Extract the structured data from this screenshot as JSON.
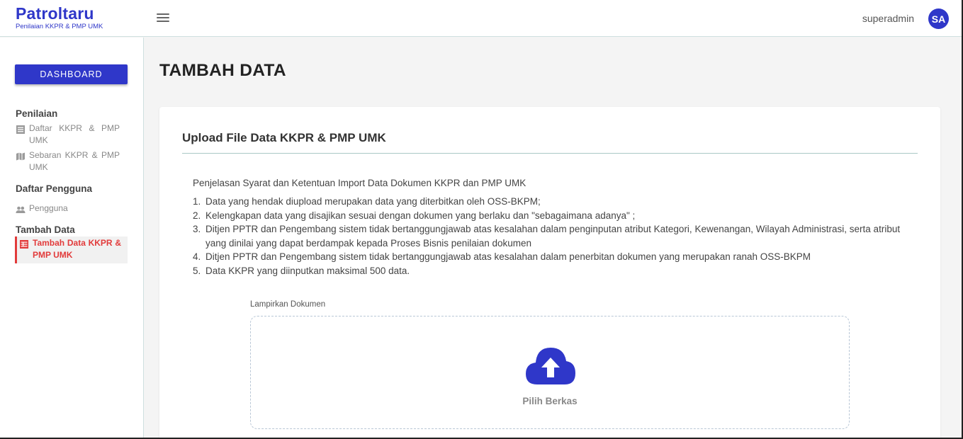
{
  "header": {
    "brand_title": "Patroltaru",
    "brand_subtitle": "Penilaian KKPR & PMP UMK",
    "menu_icon": "hamburger-icon",
    "username": "superadmin",
    "avatar_initials": "SA"
  },
  "colors": {
    "primary": "#2f37c9",
    "active": "#e23b3b"
  },
  "sidebar": {
    "dashboard_label": "DASHBOARD",
    "sections": [
      {
        "title": "Penilaian"
      },
      {
        "title": "Daftar Pengguna"
      },
      {
        "title": "Tambah Data"
      }
    ],
    "items": [
      {
        "label": "Daftar KKPR & PMP UMK",
        "icon": "list-icon"
      },
      {
        "label": "Sebaran KKPR & PMP UMK",
        "icon": "map-icon"
      },
      {
        "label": "Pengguna",
        "icon": "users-icon"
      },
      {
        "label": "Tambah Data KKPR & PMP UMK",
        "icon": "table-icon",
        "active": true
      }
    ]
  },
  "main": {
    "page_title": "TAMBAH DATA",
    "card_title": "Upload File Data KKPR & PMP UMK",
    "intro": "Penjelasan Syarat dan Ketentuan Import Data Dokumen KKPR dan PMP UMK",
    "terms": [
      {
        "num": "1.",
        "text": "Data yang hendak diupload merupakan data yang diterbitkan oleh OSS-BKPM;"
      },
      {
        "num": "2.",
        "text": "Kelengkapan data yang disajikan sesuai dengan dokumen yang berlaku dan \"sebagaimana adanya\" ;"
      },
      {
        "num": "3.",
        "text": "Ditjen PPTR dan Pengembang sistem tidak bertanggungjawab atas kesalahan dalam penginputan atribut Kategori, Kewenangan, Wilayah Administrasi, serta atribut yang dinilai yang dapat berdampak kepada Proses Bisnis penilaian dokumen"
      },
      {
        "num": "4.",
        "text": "Ditjen PPTR dan Pengembang sistem tidak bertanggungjawab atas kesalahan dalam penerbitan dokumen yang merupakan ranah OSS-BKPM"
      },
      {
        "num": "5.",
        "text": "Data KKPR yang diinputkan maksimal 500 data."
      }
    ],
    "attach_label": "Lampirkan Dokumen",
    "upload_icon": "cloud-upload-icon",
    "upload_button": "Pilih Berkas"
  }
}
